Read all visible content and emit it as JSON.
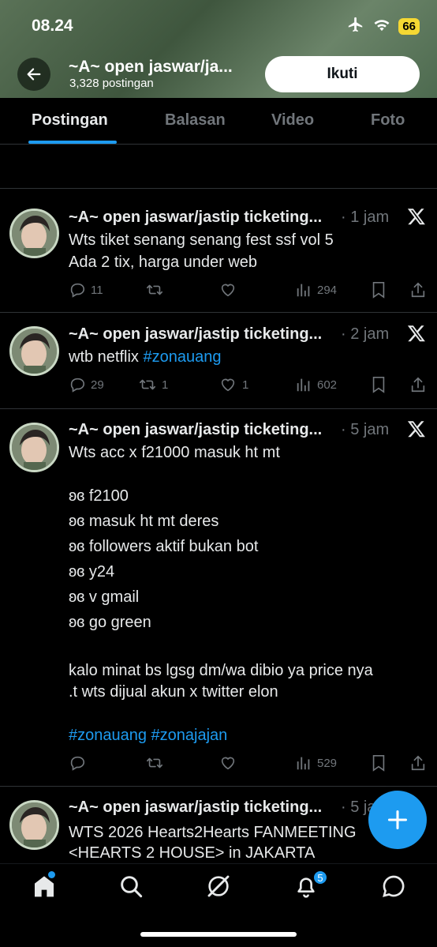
{
  "status_bar": {
    "time": "08.24",
    "battery": "66"
  },
  "header": {
    "title": "~A~ open jaswar/ja...",
    "post_count": "3,328 postingan",
    "follow_label": "Ikuti"
  },
  "tabs": [
    {
      "label": "Postingan"
    },
    {
      "label": "Balasan"
    },
    {
      "label": "Video"
    },
    {
      "label": "Foto"
    }
  ],
  "tweets": [
    {
      "name": "~A~ open jaswar/jastip ticketing...",
      "time": "1 jam",
      "lines": [
        "Wts tiket senang senang fest ssf vol 5",
        "Ada 2 tix, harga under web"
      ],
      "replies": "11",
      "retweets": "",
      "likes": "",
      "views": "294"
    },
    {
      "name": "~A~ open jaswar/jastip ticketing...",
      "time": "2 jam",
      "line_prefix": "wtb netflix ",
      "hashtag": "#zonauang",
      "replies": "29",
      "retweets": "1",
      "likes": "1",
      "views": "602"
    },
    {
      "name": "~A~ open jaswar/jastip ticketing...",
      "time": "5 jam",
      "lines": [
        "Wts acc x f21000 masuk ht mt",
        "ʚɞ f2100",
        "ʚɞ masuk ht mt deres",
        "ʚɞ followers aktif bukan bot",
        "ʚɞ y24",
        "ʚɞ v gmail",
        "ʚɞ go green",
        "kalo minat bs lgsg dm/wa dibio ya price nya",
        ".t wts dijual akun x twitter elon"
      ],
      "hashtags": "#zonauang #zonajajan",
      "replies": "",
      "retweets": "",
      "likes": "",
      "views": "529"
    },
    {
      "name": "~A~ open jaswar/jastip ticketing...",
      "time": "5 ja",
      "lines": [
        "WTS 2026 Hearts2Hearts FANMEETING",
        "<HEARTS 2 HOUSE> in JAKARTA"
      ]
    }
  ],
  "notifications_badge": "5",
  "icons": [
    "airplane-icon",
    "wifi-icon",
    "back-arrow-icon",
    "x-logo-icon",
    "reply-icon",
    "retweet-icon",
    "like-icon",
    "views-icon",
    "bookmark-icon",
    "share-icon",
    "compose-icon",
    "home-icon",
    "search-icon",
    "grok-icon",
    "bell-icon",
    "messages-icon"
  ],
  "colors": {
    "accent": "#1d9bf0",
    "text": "#e7e9ea",
    "muted": "#71767b",
    "header_bg": "#4d6a4f"
  }
}
